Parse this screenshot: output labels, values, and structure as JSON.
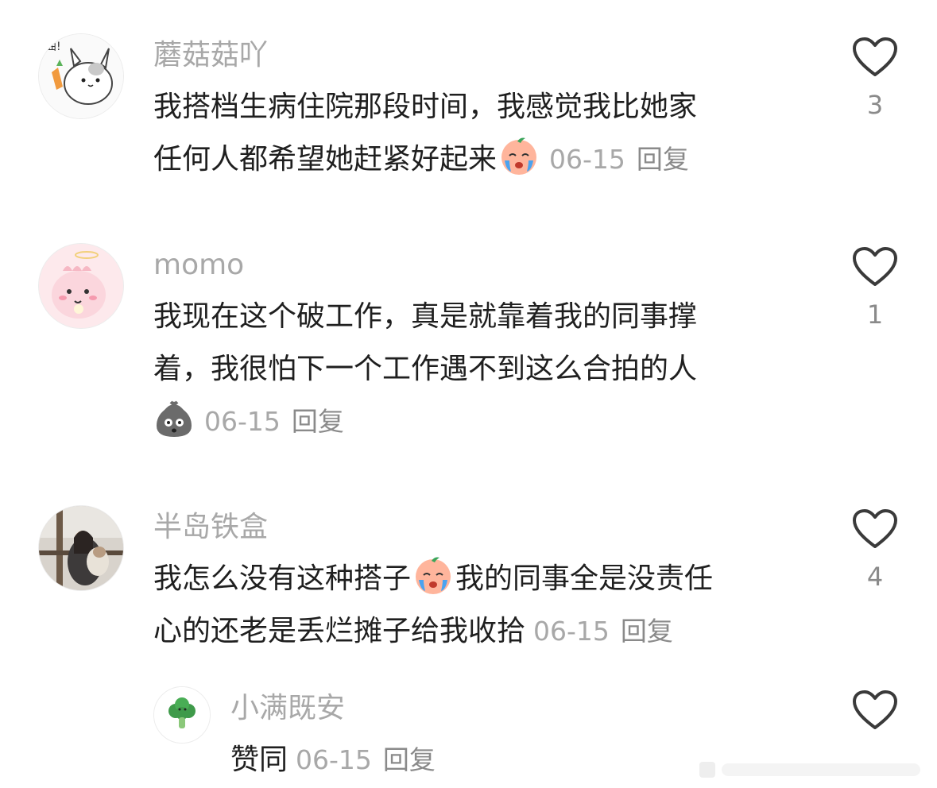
{
  "comments": [
    {
      "user": "蘑菇菇吖",
      "lines": [
        "我搭档生病住院那段时间，我感觉我比她家",
        "任何人都希望她赶紧好起来"
      ],
      "emoji": "crying-face-emoji",
      "date": "06-15",
      "reply_label": "回复",
      "likes": "3",
      "avatar": "cat-holding-carrot-avatar"
    },
    {
      "user": "momo",
      "lines": [
        "我现在这个破工作，真是就靠着我的同事撑",
        "着，我很怕下一个工作遇不到这么合拍的人"
      ],
      "emoji": "gray-sack-face-emoji",
      "date": "06-15",
      "reply_label": "回复",
      "likes": "1",
      "avatar": "pink-dinosaur-avatar"
    },
    {
      "user": "半岛铁盒",
      "lines_a": "我怎么没有这种搭子",
      "lines_b": "我的同事全是没责任",
      "line2": "心的还老是丢烂摊子给我收拾",
      "emoji": "crying-face-emoji",
      "date": "06-15",
      "reply_label": "回复",
      "likes": "4",
      "avatar": "photo-person-with-dog-avatar"
    }
  ],
  "reply": {
    "user": "小满既安",
    "text": "赞同",
    "date": "06-15",
    "reply_label": "回复",
    "avatar": "broccoli-avatar"
  },
  "colors": {
    "username": "#a8a8a8",
    "body_text": "#1f1f1f",
    "meta": "#a8a8a8",
    "heart_stroke": "#3a3a3a"
  },
  "icons": [
    "heart-icon",
    "crying-face-emoji",
    "gray-sack-face-emoji"
  ]
}
